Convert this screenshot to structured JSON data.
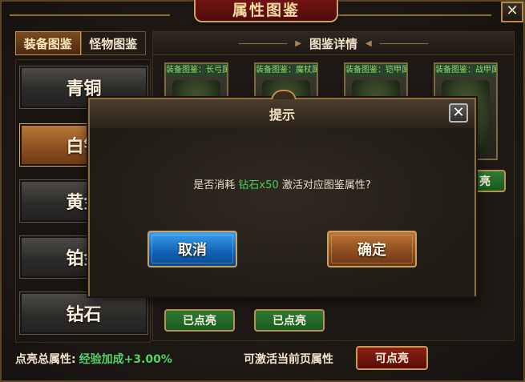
{
  "window": {
    "title": "属性图鉴",
    "close_glyph": "✕"
  },
  "category_tabs": [
    {
      "label": "装备图鉴",
      "active": true
    },
    {
      "label": "怪物图鉴",
      "active": false
    }
  ],
  "grades": [
    {
      "label": "青铜",
      "active": false
    },
    {
      "label": "白银",
      "active": true
    },
    {
      "label": "黄金",
      "active": false
    },
    {
      "label": "铂金",
      "active": false
    },
    {
      "label": "钻石",
      "active": false
    }
  ],
  "detail": {
    "header": "图鉴详情",
    "cards": [
      {
        "label": "装备图鉴：长弓属"
      },
      {
        "label": "装备图鉴：魔杖属"
      },
      {
        "label": "装备图鉴：铠甲属"
      },
      {
        "label": "装备图鉴：战甲属"
      }
    ],
    "visible_lit_buttons": [
      "已点亮",
      "已点亮"
    ],
    "partial_button": "亮"
  },
  "bottom": {
    "total_label": "点亮总属性:",
    "total_value": "经验加成+3.00%",
    "activate_label": "可激活当前页属性",
    "activate_button": "可点亮"
  },
  "dialog": {
    "title": "提示",
    "close_glyph": "✕",
    "message_prefix": "是否消耗",
    "message_highlight": "钻石x50",
    "message_suffix": "激活对应图鉴属性?",
    "cancel_label": "取消",
    "confirm_label": "确定"
  },
  "colors": {
    "highlight_green": "#46d05c",
    "gold_border": "#c9a35d",
    "cancel_blue": "#1060b4",
    "confirm_brown": "#8a4b1e"
  }
}
